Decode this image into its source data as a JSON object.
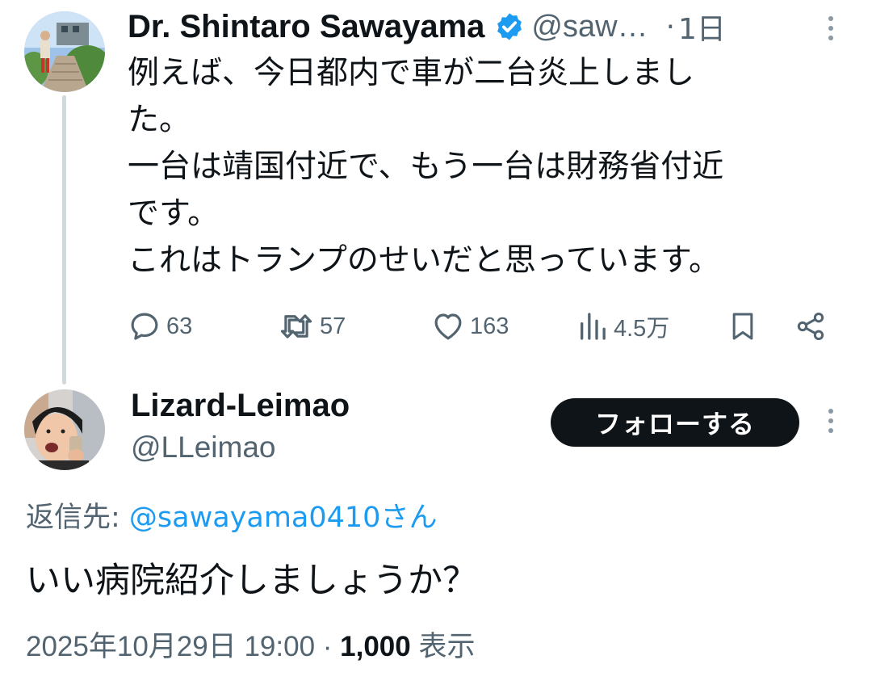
{
  "parent_tweet": {
    "author_name": "Dr. Shintaro Sawayama",
    "verified": true,
    "handle": "@saw…",
    "separator": "·",
    "time": "1日",
    "avatar": "person-on-stairs-photo",
    "body_lines": [
      "例えば、今日都内で車が二台炎上しまし",
      "た。",
      "一台は靖国付近で、もう一台は財務省付近",
      "です。",
      "これはトランプのせいだと思っています。"
    ],
    "actions": {
      "reply": {
        "icon": "reply-icon",
        "count": "63"
      },
      "retweet": {
        "icon": "retweet-icon",
        "count": "57"
      },
      "like": {
        "icon": "heart-icon",
        "count": "163"
      },
      "views": {
        "icon": "views-chart-icon",
        "count": "4.5万"
      },
      "bookmark": {
        "icon": "bookmark-icon"
      },
      "share": {
        "icon": "share-icon"
      }
    }
  },
  "reply_tweet": {
    "author_name": "Lizard-Leimao",
    "handle": "@LLeimao",
    "avatar": "woman-with-phone-photo",
    "follow_label": "フォローする",
    "reply_to_prefix": "返信先: ",
    "reply_to_mention": "@sawayama0410",
    "reply_to_suffix": "さん",
    "body": "いい病院紹介しましょうか？",
    "timestamp": "2025年10月29日 19:00",
    "meta_separator": " · ",
    "views_count": "1,000",
    "views_label": " 表示"
  },
  "colors": {
    "text": "#0f1419",
    "secondary": "#536471",
    "link": "#1d9bf0",
    "verified": "#1d9bf0",
    "thread_line": "#cfd9de",
    "button_bg": "#0f1419"
  }
}
